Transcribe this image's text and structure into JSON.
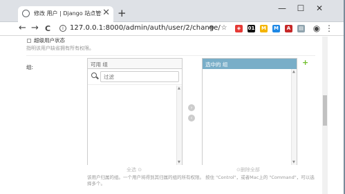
{
  "browser": {
    "tab_title": "修改 用户 | Django 站点管理员",
    "tab_close": "✕",
    "new_tab": "+",
    "minimize": "—",
    "maximize": "☐",
    "close": "✕",
    "back": "←",
    "forward": "→",
    "reload": "C",
    "url": "127.0.0.1:8000/admin/auth/user/2/change/",
    "info_icon": "i",
    "zoom_icon": "⊕",
    "star_icon": "☆",
    "extensions": [
      {
        "name": "shield",
        "text": "◈",
        "color": "#e53935"
      },
      {
        "name": "ext-01",
        "text": "01",
        "color": "#111111"
      },
      {
        "name": "ext-m",
        "text": "M",
        "color": "#f4b400"
      },
      {
        "name": "ext-m2",
        "text": "M",
        "color": "#1e88e5"
      },
      {
        "name": "ext-pdf",
        "text": "A",
        "color": "#c62828"
      },
      {
        "name": "ext-doc",
        "text": "▤",
        "color": "#90a4ae"
      }
    ],
    "profile_icon": "◉",
    "menu_icon": "⋮"
  },
  "form": {
    "superuser_label": "超级用户状态",
    "superuser_help": "指明该用户缺省拥有所有权限。",
    "groups_label": "组:",
    "available_title": "可用 组",
    "filter_placeholder": "过滤",
    "chosen_title": "选中的 组",
    "add_symbol": "+",
    "move_right": "›",
    "move_left": "‹",
    "choose_all": "全选 ⊙",
    "remove_all": "⊙删除全部",
    "help_text": "该用户归属的组。一个用户将得到其归属的组的所有权限。 按住 \"Control\"，或者Mac上的 \"Command\"，可以选择多个。"
  },
  "colors": {
    "chosen_header": "#79aec8",
    "add_green": "#70bf2b"
  }
}
